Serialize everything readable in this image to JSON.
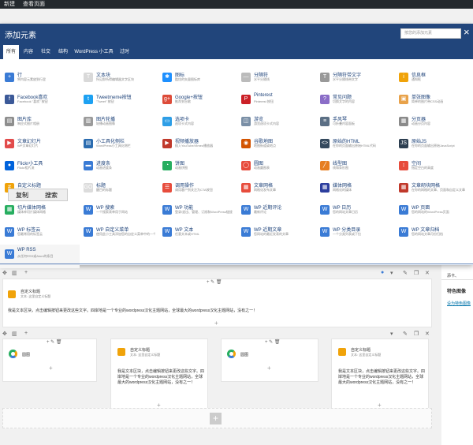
{
  "adminbar": {
    "items": [
      "新建",
      "查看页面"
    ]
  },
  "modal": {
    "title": "添加元素",
    "search_placeholder": "按您的添加元素",
    "close": "×",
    "tabs": [
      "所有",
      "内容",
      "社交",
      "结构",
      "WordPress 小工具",
      "过时"
    ]
  },
  "widgets": [
    {
      "name": "行",
      "desc": "将内容元素放到行里",
      "color": "#3a7bd5",
      "glyph": "+"
    },
    {
      "name": "文本块",
      "desc": "所见即所得编辑器文字区块",
      "color": "#d9d9d9",
      "glyph": "T"
    },
    {
      "name": "图标",
      "desc": "酷炫的矢量图标库",
      "color": "#1e90ff",
      "glyph": "✱"
    },
    {
      "name": "分隔符",
      "desc": "水平分隔线",
      "color": "#bbb",
      "glyph": "—"
    },
    {
      "name": "分隔符带文字",
      "desc": "水平分隔线带文字",
      "color": "#999",
      "glyph": "T"
    },
    {
      "name": "信息框",
      "desc": "通知框",
      "color": "#f0a30a",
      "glyph": "i"
    },
    {
      "name": "Facebook喜欢",
      "desc": "Facebook \"喜欢\" 按钮",
      "color": "#3b5998",
      "glyph": "f"
    },
    {
      "name": "Tweetmeme按钮",
      "desc": "\"Tweet\" 按钮",
      "color": "#1da1f2",
      "glyph": "t"
    },
    {
      "name": "Google+按钮",
      "desc": "推荐到谷歌",
      "color": "#dd4b39",
      "glyph": "g+"
    },
    {
      "name": "Pinterest",
      "desc": "Pinterest 按钮",
      "color": "#cb2027",
      "glyph": "P"
    },
    {
      "name": "常见问题",
      "desc": "切换文字的内容",
      "color": "#8a6dc7",
      "glyph": "?"
    },
    {
      "name": "单张图像",
      "desc": "简单的图片带CSS动画",
      "color": "#e8a24a",
      "glyph": "▣"
    },
    {
      "name": "图片库",
      "desc": "响应式图片相册",
      "color": "#8e8e8e",
      "glyph": "▤"
    },
    {
      "name": "图片轮播",
      "desc": "轮播动画图像",
      "color": "#9b9b9b",
      "glyph": "▥"
    },
    {
      "name": "选项卡",
      "desc": "选项卡式内容",
      "color": "#2e9ee6",
      "glyph": "▭"
    },
    {
      "name": "游览",
      "desc": "游览选项卡式内容",
      "color": "#7a8fa6",
      "glyph": "◫"
    },
    {
      "name": "手风琴",
      "desc": "可折叠内容面板",
      "color": "#5b6f85",
      "glyph": "≡"
    },
    {
      "name": "分页器",
      "desc": "动画分页内容",
      "color": "#8a8a8a",
      "glyph": "▦"
    },
    {
      "name": "文章幻灯片",
      "desc": "WP文章幻灯片",
      "color": "#e24b4b",
      "glyph": "▶"
    },
    {
      "name": "小工具化侧栏",
      "desc": "WordPress小工具化侧栏",
      "color": "#2b6cb0",
      "glyph": "▤"
    },
    {
      "name": "视频播放器",
      "desc": "插入YouTube/Vimeo播放器",
      "color": "#c0392b",
      "glyph": "▶"
    },
    {
      "name": "谷歌地图",
      "desc": "地图街道或地点",
      "color": "#d35400",
      "glyph": "◉"
    },
    {
      "name": "原始的HTML",
      "desc": "在你的页面输出原始HTML代码",
      "color": "#34495e",
      "glyph": "<>"
    },
    {
      "name": "原始JS",
      "desc": "在你的页面输出原始JavaScript",
      "color": "#2c3e50",
      "glyph": "JS"
    },
    {
      "name": "Flickr小工具",
      "desc": "Flickr相片流",
      "color": "#0063dc",
      "glyph": "●"
    },
    {
      "name": "进度条",
      "desc": "动画进度条",
      "color": "#3a7bd5",
      "glyph": "▬"
    },
    {
      "name": "饼图",
      "desc": "动画饼图",
      "color": "#27ae60",
      "glyph": "◔"
    },
    {
      "name": "圆图",
      "desc": "动画圆图表",
      "color": "#e74c3c",
      "glyph": "◯"
    },
    {
      "name": "线型图",
      "desc": "线和条形图",
      "color": "#e67e22",
      "glyph": "╱"
    },
    {
      "name": "空间",
      "desc": "指定空白的高度",
      "color": "#e74c3c",
      "glyph": "↕"
    },
    {
      "name": "自定义标题",
      "desc": "自定义文字",
      "color": "#f0a30a",
      "glyph": "#"
    },
    {
      "name": "标题",
      "desc": "醒目的标题",
      "color": "#dcdcdc",
      "glyph": "GO"
    },
    {
      "name": "调用操作",
      "desc": "调用客户到关注为CTA按钮",
      "color": "#e74c3c",
      "glyph": "☰"
    },
    {
      "name": "文章网格",
      "desc": "网格化发布文章",
      "color": "#e74c3c",
      "glyph": "▦"
    },
    {
      "name": "媒体网格",
      "desc": "网格化的媒体",
      "color": "#2c3e9e",
      "glyph": "▦"
    },
    {
      "name": "文章砌块网格",
      "desc": "在你的网格的文章、页面和自定义文章",
      "color": "#c0392b",
      "glyph": "▦"
    },
    {
      "name": "切片媒体网格",
      "desc": "媒体库切片媒体网格",
      "color": "#27ae60",
      "glyph": "▦"
    },
    {
      "name": "WP 搜索",
      "desc": "一个搜索表单用于网站",
      "color": "#3a7bd5",
      "glyph": "W"
    },
    {
      "name": "WP 功能",
      "desc": "登录/退出、管理、订阅和WordPress链接",
      "color": "#3a7bd5",
      "glyph": "W"
    },
    {
      "name": "WP 近期评论",
      "desc": "最新评论",
      "color": "#3a7bd5",
      "glyph": "W"
    },
    {
      "name": "WP 日历",
      "desc": "您的网站文章日历",
      "color": "#3a7bd5",
      "glyph": "W"
    },
    {
      "name": "WP 页面",
      "desc": "您的网站的WordPress页面",
      "color": "#3a7bd5",
      "glyph": "W"
    },
    {
      "name": "WP 标签云",
      "desc": "您最常用的标签云",
      "color": "#3a7bd5",
      "glyph": "W"
    },
    {
      "name": "WP 自定义菜单",
      "desc": "使用此小工具添加您的自定义菜单中的一个作为侧边栏小工具",
      "color": "#3a7bd5",
      "glyph": "W"
    },
    {
      "name": "WP 文本",
      "desc": "任意文本或HTML",
      "color": "#3a7bd5",
      "glyph": "W"
    },
    {
      "name": "WP 近期文章",
      "desc": "您网站的最近发表的文章",
      "color": "#3a7bd5",
      "glyph": "W"
    },
    {
      "name": "WP 分类目录",
      "desc": "一个分类列表或下拉",
      "color": "#3a7bd5",
      "glyph": "W"
    },
    {
      "name": "WP 文章归档",
      "desc": "您的网站文章月份归档",
      "color": "#3a7bd5",
      "glyph": "W"
    },
    {
      "name": "WP RSS",
      "desc": "从任何RSS或Atom的条目",
      "color": "#3a7bd5",
      "glyph": "W"
    }
  ],
  "context_menu": {
    "copy": "复制",
    "search": "搜索"
  },
  "builder": {
    "heading_title": "自定义标题",
    "heading_sub": "文本: 这里自定义标题",
    "body_text": "我是文本区块，点击编辑按钮来更改这些文字。四岸地是一个专业的wordpress汉化主题网站，全球最大的wordpress汉化主题网站，没有之一！",
    "circle_title": "圆图",
    "card_text": "我是文本区块，点击编辑按钮来更改这些文字。四岸地是一个专业的wordpress汉化主题网站，全球最大的wordpress汉化主题网站，没有之一！"
  },
  "sidebar": {
    "label1": "添卡、",
    "label2": "特色图像",
    "link": "设为特色图像"
  }
}
